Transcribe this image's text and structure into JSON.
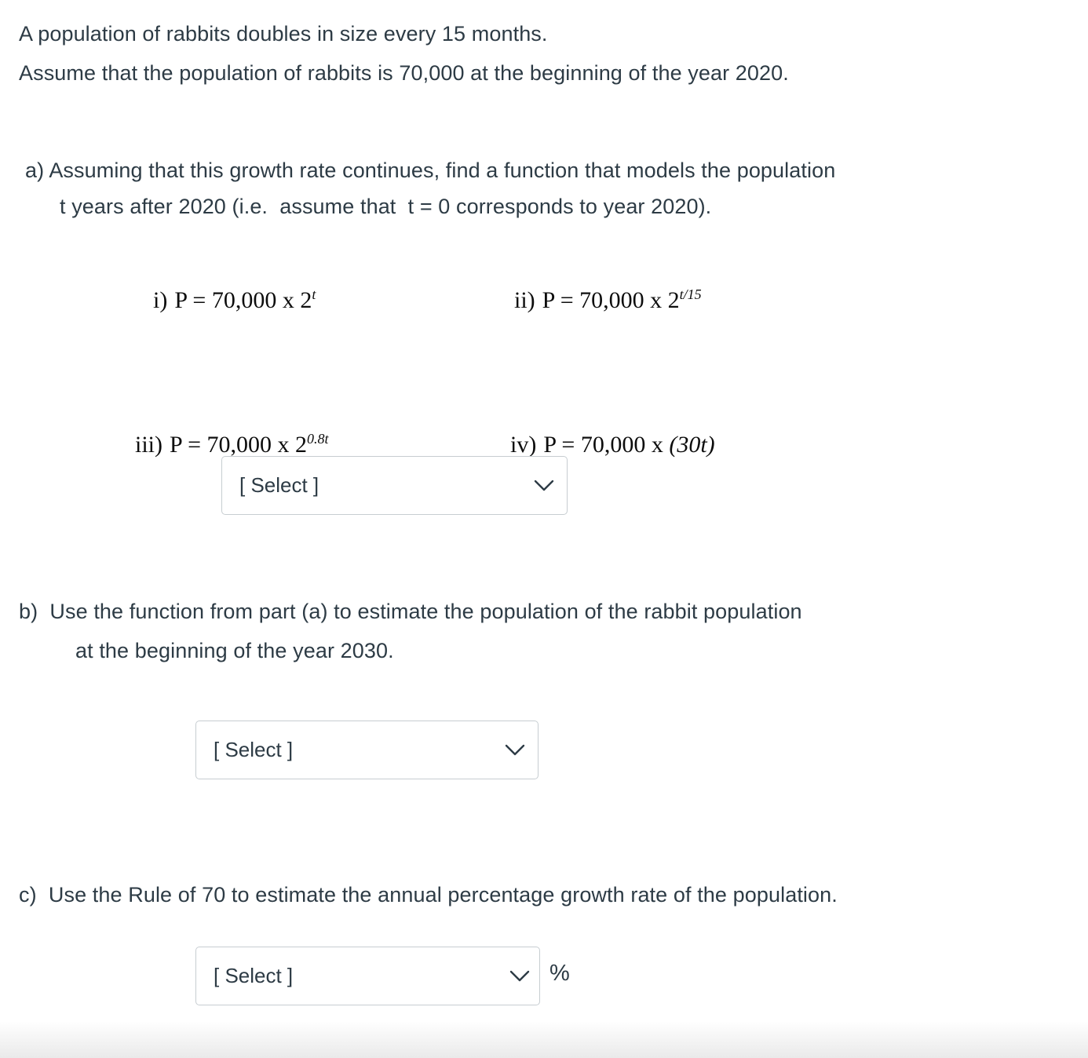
{
  "question": {
    "intro": {
      "line1": "A population of rabbits doubles in size every 15 months.",
      "line2": "Assume that the population of rabbits is 70,000 at the beginning of the year 2020."
    },
    "part_a": {
      "line1": "a) Assuming that this growth rate continues, find a function that models the population",
      "line2": "t years after 2020 (i.e.  assume that  t = 0 corresponds to year 2020).",
      "options": [
        {
          "label": "i)",
          "expr_prefix": "P = 70,000 x 2",
          "exponent": "t",
          "paren": ""
        },
        {
          "label": "ii)",
          "expr_prefix": "P = 70,000 x 2",
          "exponent": "t/15",
          "paren": ""
        },
        {
          "label": "iii)",
          "expr_prefix": "P = 70,000 x 2",
          "exponent": "0.8t",
          "paren": ""
        },
        {
          "label": "iv)",
          "expr_prefix": "P = 70,000 x ",
          "exponent": "",
          "paren": "(30t)"
        }
      ],
      "select": {
        "value": "[ Select ]",
        "icon": "chevron-down-icon"
      }
    },
    "part_b": {
      "line1": "b)  Use the function from part (a) to estimate the population of the rabbit population",
      "line2": "at the beginning of the year 2030.",
      "select": {
        "value": "[ Select ]",
        "icon": "chevron-down-icon"
      }
    },
    "part_c": {
      "line1": "c)  Use the Rule of 70 to estimate the annual percentage growth rate of the population.",
      "select": {
        "value": "[ Select ]",
        "icon": "chevron-down-icon"
      },
      "unit": "%"
    }
  },
  "colors": {
    "text": "#2d3b45",
    "math_text": "#0d0d0d",
    "select_border": "#c7cdd1",
    "page_background": "#ffffff"
  }
}
